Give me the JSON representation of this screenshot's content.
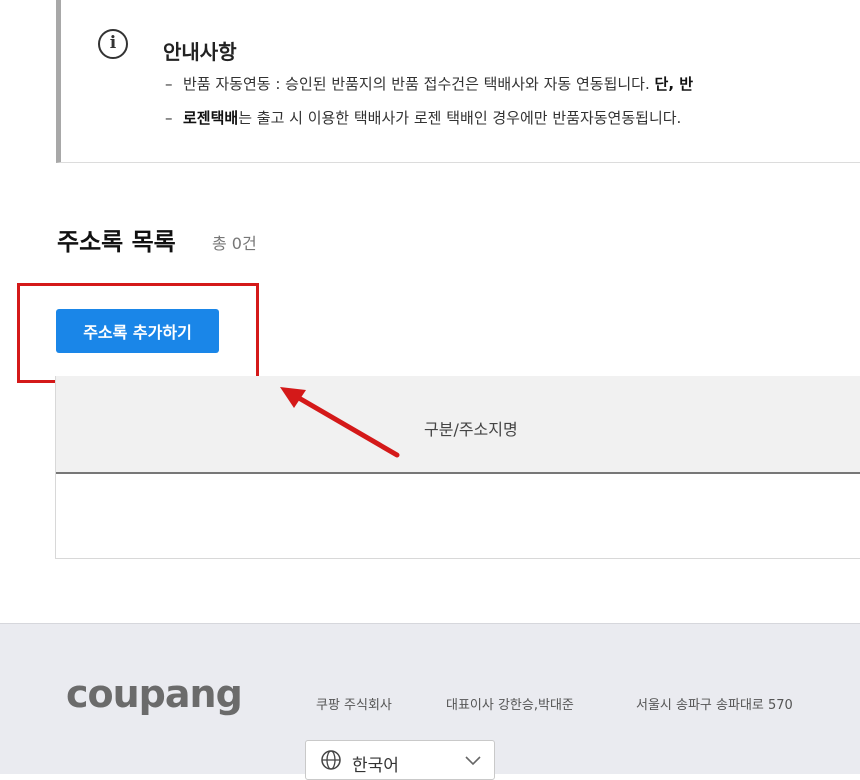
{
  "notice": {
    "title": "안내사항",
    "line1_prefix": "반품 자동연동 : 승인된 반품지의 반품 접수건은 택배사와 자동 연동됩니다.",
    "line1_bold": "단, 반",
    "line2_bold": "로젠택배",
    "line2_rest": "는 출고 시 이용한 택배사가 로젠 택배인 경우에만 반품자동연동됩니다."
  },
  "address_list": {
    "title": "주소록 목록",
    "count": "총 0건",
    "add_button_label": "주소록 추가하기",
    "table_headers": [
      "구분/주소지명"
    ]
  },
  "footer": {
    "logo_text": "coupang",
    "links": [
      "쿠팡 주식회사",
      "대표이사 강한승,박대준",
      "서울시 송파구 송파대로 570"
    ],
    "language": "한국어"
  },
  "colors": {
    "button_blue": "#1a86e8",
    "highlight_red": "#d41919",
    "footer_bg": "#eaebf0"
  },
  "icons": [
    "info-icon",
    "arrow-annotation-icon",
    "globe-icon",
    "chevron-down-icon"
  ]
}
